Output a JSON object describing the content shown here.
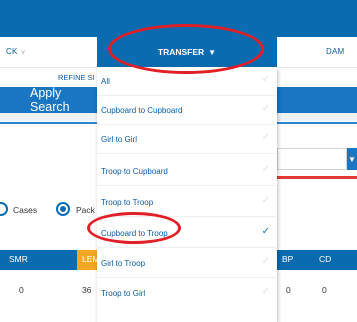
{
  "nav": {
    "left_label": "CK",
    "right_label": "DAM",
    "transfer_label": "TRANSFER"
  },
  "filters": {
    "refine_label": "REFINE SI",
    "apply_label": "Apply Search"
  },
  "units": {
    "cases_label": "Cases",
    "packages_label": "Pack",
    "selected": "packages"
  },
  "table": {
    "headers": [
      "SMR",
      "LEM",
      "BP",
      "CD"
    ],
    "row": [
      "0",
      "36",
      "0",
      "0"
    ]
  },
  "menu": {
    "items": [
      {
        "label": "All",
        "checked": false
      },
      {
        "label": "Cupboard to Cupboard",
        "checked": false
      },
      {
        "label": "Girl to Girl",
        "checked": false
      },
      {
        "label": "Troop to Cupboard",
        "checked": false
      },
      {
        "label": "Troop to Troop",
        "checked": false
      },
      {
        "label": "Cupboard to Troop",
        "checked": true
      },
      {
        "label": "Girl to Troop",
        "checked": false
      },
      {
        "label": "Troop to Girl",
        "checked": false
      }
    ]
  },
  "colors": {
    "brand_blue": "#0b6bb0",
    "accent_orange": "#f5a623",
    "annotation_red": "#e01f26"
  }
}
